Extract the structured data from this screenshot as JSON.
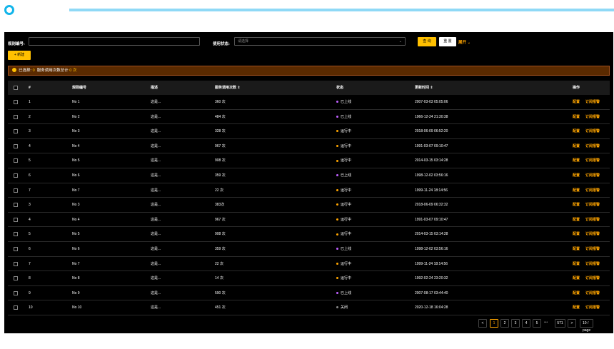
{
  "search": {
    "rule_label": "规则编号:",
    "rule_value": "",
    "status_label": "使用状态:",
    "status_placeholder": "请选择",
    "query_label": "查 询",
    "reset_label": "重 置",
    "expand_label": "展开"
  },
  "toolbar": {
    "new_label": "新建"
  },
  "alert": {
    "selected_label": "已选择",
    "selected_count": "0",
    "sum_label": "服务调用次数总计",
    "sum_value": "0 次"
  },
  "table": {
    "headers": [
      "#",
      "规则编号",
      "描述",
      "服务调用次数",
      "状态",
      "更新时间",
      "操作"
    ],
    "op_config": "配置",
    "op_subscribe": "订阅报警",
    "rows": [
      {
        "idx": "1",
        "name": "No 1",
        "desc": "这是...",
        "calls": "360 次",
        "status": "已上线",
        "status_color": "#c060ff",
        "time": "2007-03-03 05:05:06"
      },
      {
        "idx": "2",
        "name": "No 2",
        "desc": "这是...",
        "calls": "484 次",
        "status": "已上线",
        "status_color": "#c060ff",
        "time": "1966-12-24 21:30:38"
      },
      {
        "idx": "3",
        "name": "No 3",
        "desc": "这是...",
        "calls": "328 次",
        "status": "运行中",
        "status_color": "#ffa500",
        "time": "2018-06-09 06:52:20"
      },
      {
        "idx": "4",
        "name": "No 4",
        "desc": "这是...",
        "calls": "967 次",
        "status": "运行中",
        "status_color": "#ffa500",
        "time": "1991-03-07 09:10:47"
      },
      {
        "idx": "5",
        "name": "No 5",
        "desc": "这是...",
        "calls": "908 次",
        "status": "运行中",
        "status_color": "#ffa500",
        "time": "2014-03-15 03:14:28"
      },
      {
        "idx": "6",
        "name": "No 6",
        "desc": "这是...",
        "calls": "359 次",
        "status": "已上线",
        "status_color": "#c060ff",
        "time": "1998-12-02 03:56:16"
      },
      {
        "idx": "7",
        "name": "No 7",
        "desc": "这是...",
        "calls": "22 次",
        "status": "运行中",
        "status_color": "#ffa500",
        "time": "1999-11-24 18:14:56"
      },
      {
        "idx": "3",
        "name": "No 3",
        "desc": "这是...",
        "calls": "383次",
        "status": "运行中",
        "status_color": "#ffa500",
        "time": "2018-06-09 06:32:32"
      },
      {
        "idx": "4",
        "name": "No 4",
        "desc": "这是...",
        "calls": "967 次",
        "status": "运行中",
        "status_color": "#ffa500",
        "time": "1991-03-07 09:10:47"
      },
      {
        "idx": "5",
        "name": "No 5",
        "desc": "这是...",
        "calls": "908 次",
        "status": "运行中",
        "status_color": "#ffa500",
        "time": "2014-03-15 03:14:28"
      },
      {
        "idx": "6",
        "name": "No 6",
        "desc": "这是...",
        "calls": "359 次",
        "status": "已上线",
        "status_color": "#c060ff",
        "time": "1998-12-02 03:56:16"
      },
      {
        "idx": "7",
        "name": "No 7",
        "desc": "这是...",
        "calls": "22 次",
        "status": "运行中",
        "status_color": "#ffa500",
        "time": "1999-11-24 18:14:56"
      },
      {
        "idx": "8",
        "name": "No 8",
        "desc": "这是...",
        "calls": "14 次",
        "status": "运行中",
        "status_color": "#ffa500",
        "time": "1992-02-24 23:20:32"
      },
      {
        "idx": "9",
        "name": "No 9",
        "desc": "这是...",
        "calls": "590 次",
        "status": "已上线",
        "status_color": "#c060ff",
        "time": "2007-08-17 03:44:40"
      },
      {
        "idx": "10",
        "name": "No 10",
        "desc": "这是...",
        "calls": "451 次",
        "status": "关闭",
        "status_color": "#888888",
        "time": "2020-12-18 16:04:28"
      }
    ]
  },
  "pagination": {
    "prev": "<",
    "pages": [
      "1",
      "2",
      "3",
      "4",
      "5"
    ],
    "ellipsis": "•••",
    "last": "571",
    "next": ">",
    "page_size": "10 / page"
  },
  "colors": {
    "accent": "#ffc000",
    "link": "#ffa500",
    "bg": "#000000"
  }
}
